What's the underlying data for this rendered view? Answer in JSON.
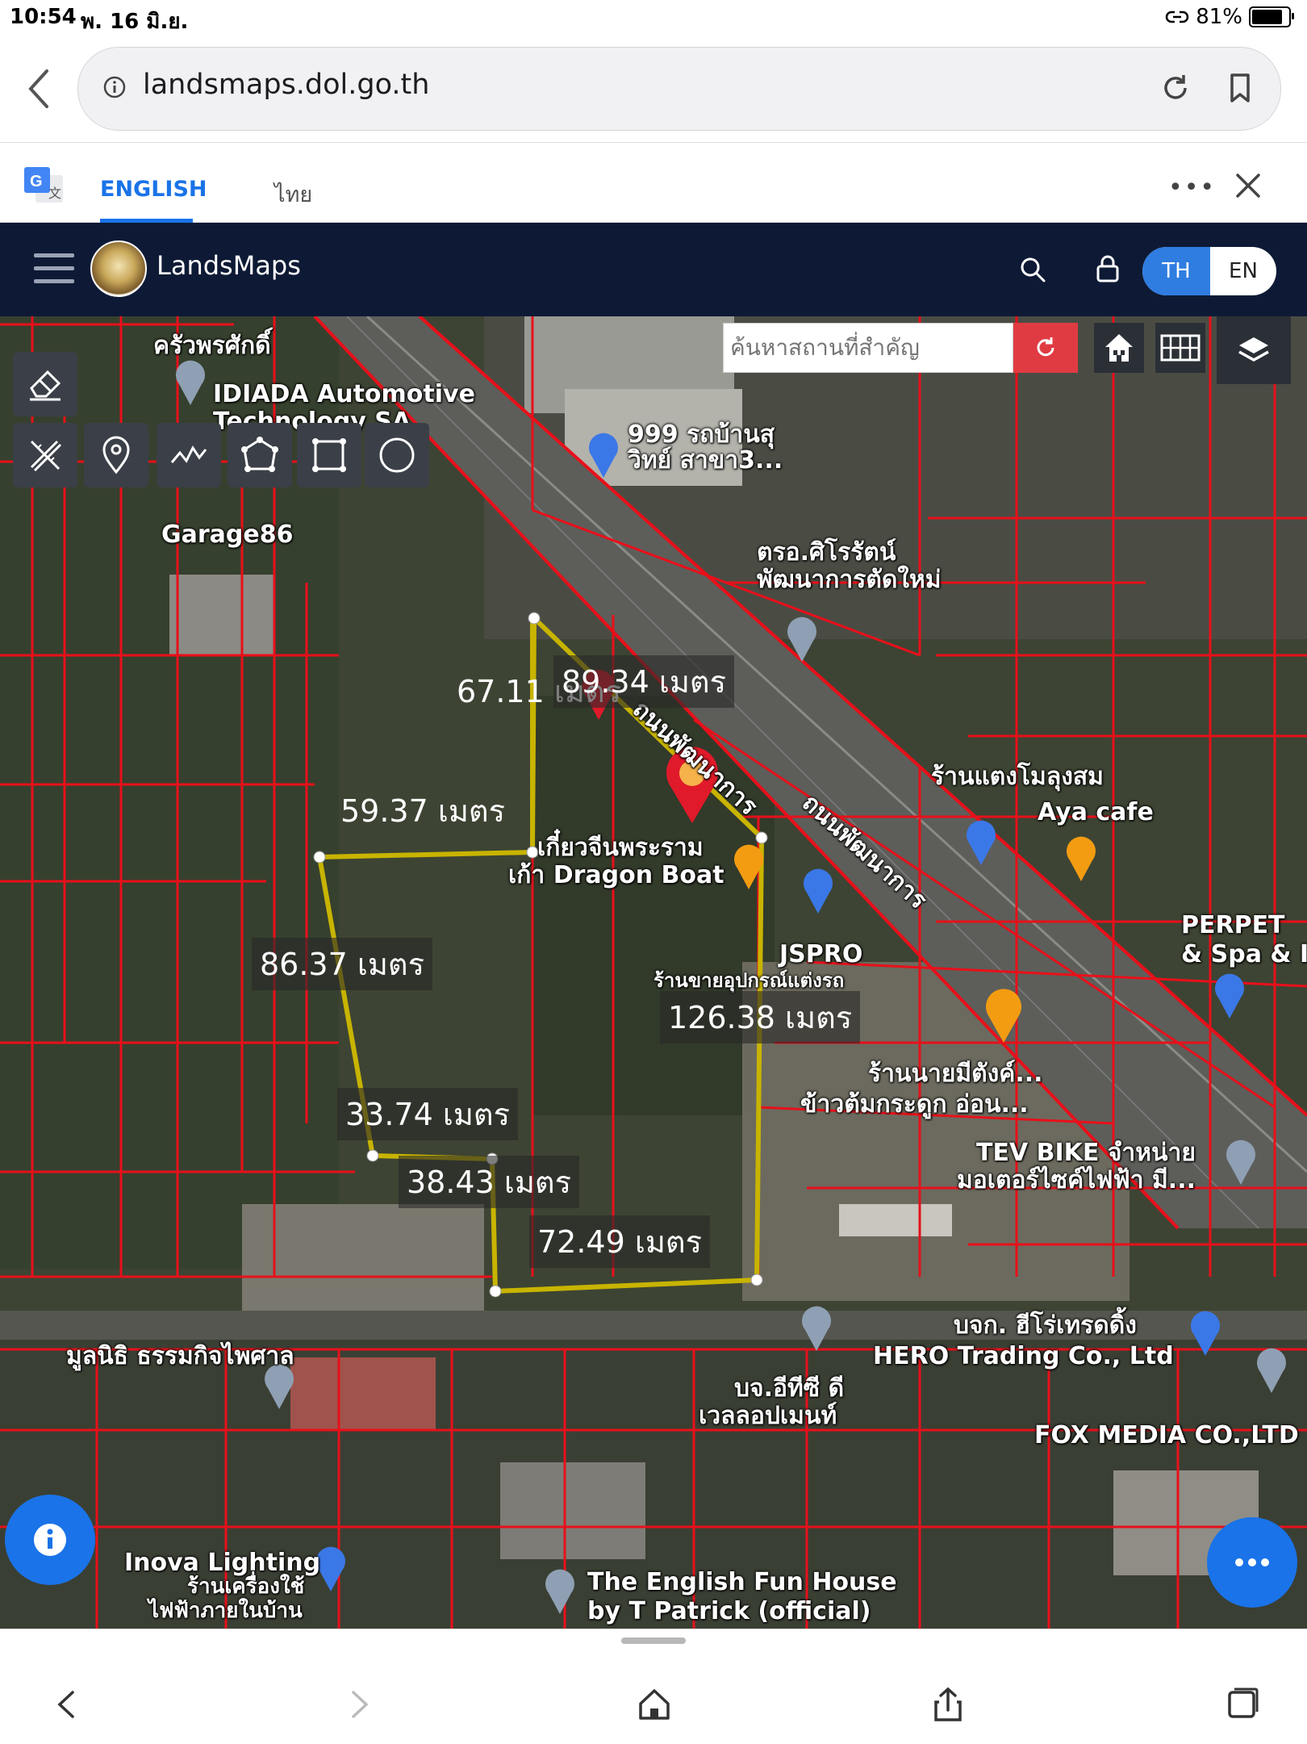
{
  "status": {
    "time": "10:54",
    "date": "พ. 16 มิ.ย.",
    "battery": "81%",
    "battery_level": 0.81
  },
  "browser": {
    "url": "landsmaps.dol.go.th"
  },
  "translate": {
    "english_label": "ENGLISH",
    "thai_label": "ไทย",
    "more": "•••"
  },
  "app": {
    "title": "LandsMaps",
    "lang_th": "TH",
    "lang_en": "EN",
    "active_lang": "TH"
  },
  "map": {
    "search_placeholder": "ค้นหาสถานที่สำคัญ",
    "labels": {
      "l1": "ครัวพรศักดิ์",
      "l2": "IDIADA Automotive",
      "l3": "Technology SA",
      "l4": "999 รถบ้านสุ",
      "l5": "วิทย์ สาขา3...",
      "l6": "Garage86",
      "l7": "ตรอ.ศิโรรัตน์",
      "l8": "พัฒนาการตัดใหม่",
      "l9": "ร้านแตงโมลุงสม",
      "l10": "Aya cafe",
      "l11": "ถนนพัฒนาการ",
      "l12": "ถนนพัฒนาการ",
      "l13": "เกี๋ยวจีนพระราม",
      "l14": "เก้า Dragon Boat",
      "l15": "JSPRO",
      "l16": "ร้านขายอุปกรณ์แต่งรถ",
      "l17": "PERPET",
      "l18": "& Spa & I",
      "l19": "ร้านนายมีตังค์...",
      "l20": "ข้าวต้มกระดูก อ่อน...",
      "l21": "TEV BIKE จำหน่าย",
      "l22": "มอเตอร์ไซค์ไฟฟ้า มี...",
      "l23": "บจก. ฮีโร่เทรดดิ้ง",
      "l24": "HERO Trading Co., Ltd",
      "l25": "มูลนิธิ ธรรมกิจไพศาล",
      "l26": "บจ.อีทีซี ดี",
      "l27": "เวลลอปเมนท์",
      "l28": "FOX MEDIA CO.,LTD",
      "l29": "Inova Lighting",
      "l30": "ร้านเครื่องใช้",
      "l31": "ไฟฟ้าภายในบ้าน",
      "l32": "The English Fun House",
      "l33": "by T Patrick (official)"
    },
    "measures": {
      "m1": "67.11 เมตร",
      "m2": "89.34 เมตร",
      "m3": "59.37 เมตร",
      "m4": "86.37 เมตร",
      "m5": "126.38 เมตร",
      "m6": "33.74 เมตร",
      "m7": "38.43 เมตร",
      "m8": "72.49 เมตร"
    }
  },
  "icons": [
    "back-icon",
    "info-icon",
    "reload-icon",
    "bookmark-icon",
    "google-translate-icon",
    "close-icon",
    "menu-icon",
    "search-icon",
    "lock-icon",
    "eraser-icon",
    "ruler-pencil-icon",
    "marker-icon",
    "polyline-icon",
    "polygon-icon",
    "rectangle-icon",
    "circle-icon",
    "refresh-icon",
    "home-icon",
    "grid-icon",
    "layers-icon",
    "home-nav-icon",
    "share-icon",
    "tabs-icon"
  ],
  "colors": {
    "appbar": "#0e1a35",
    "accent": "#2f7de1",
    "parcel_lines": "#e8101a",
    "measure_line": "#c8b400",
    "search_button": "#e03b42"
  }
}
